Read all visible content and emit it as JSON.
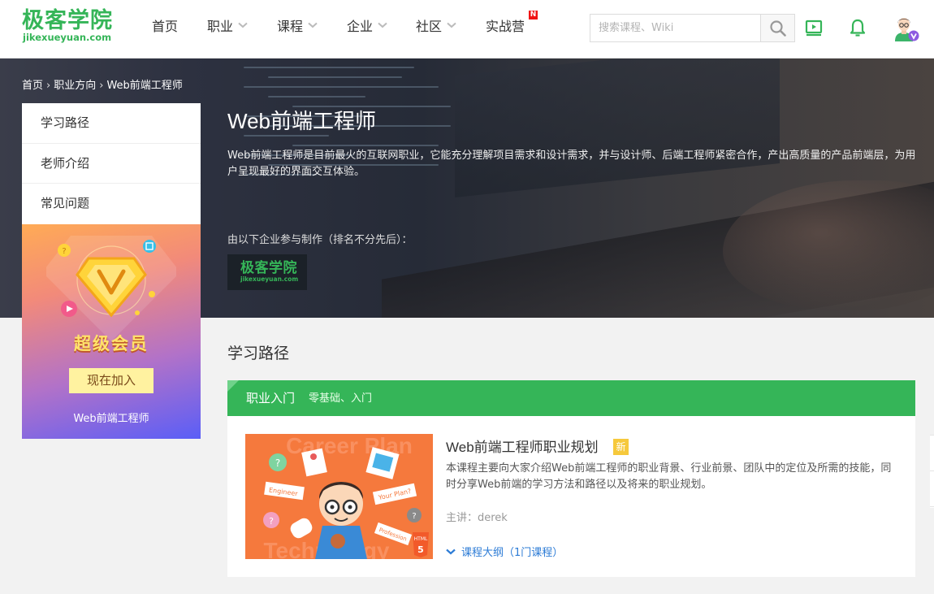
{
  "brand": {
    "logo_cn": "极客学院",
    "logo_en": "jikexueyuan.com",
    "color": "#35b558"
  },
  "nav": {
    "items": [
      {
        "label": "首页",
        "has_dropdown": false
      },
      {
        "label": "职业",
        "has_dropdown": true
      },
      {
        "label": "课程",
        "has_dropdown": true
      },
      {
        "label": "企业",
        "has_dropdown": true
      },
      {
        "label": "社区",
        "has_dropdown": true
      },
      {
        "label": "实战营",
        "has_dropdown": false,
        "badge": "N"
      }
    ]
  },
  "search": {
    "placeholder": "搜索课程、Wiki",
    "value": ""
  },
  "header_icons": [
    "video-icon",
    "bell-icon",
    "user-avatar-icon"
  ],
  "breadcrumb": [
    "首页",
    "职业方向",
    "Web前端工程师"
  ],
  "sidebar": {
    "items": [
      {
        "label": "学习路径"
      },
      {
        "label": "老师介绍"
      },
      {
        "label": "常见问题"
      }
    ],
    "vip": {
      "title": "超级会员",
      "button": "现在加入",
      "subtitle": "Web前端工程师"
    }
  },
  "job": {
    "title": "Web前端工程师",
    "description": "Web前端工程师是目前最火的互联网职业，它能充分理解项目需求和设计需求，并与设计师、后端工程师紧密合作，产出高质量的产品前端层，为用户呈现最好的界面交互体验。",
    "partners_label": "由以下企业参与制作（排名不分先后）：",
    "partner_logo_cn": "极客学院",
    "partner_logo_en": "jikexueyuan.com"
  },
  "learning_path": {
    "title": "学习路径",
    "stage": {
      "name": "职业入门",
      "subtitle": "零基础、入门"
    },
    "course": {
      "name": "Web前端工程师职业规划",
      "tag": "新",
      "description": "本课程主要向大家介绍Web前端工程师的职业背景、行业前景、团队中的定位及所需的技能，同时分享Web前端的学习方法和路径以及将来的职业规划。",
      "teacher": "主讲：derek",
      "outline": "课程大纲（1门课程）",
      "image_texts": {
        "top": "Career Plan",
        "bottom": "Technology",
        "tag1": "Engineer",
        "tag2": "Your Plan?",
        "tag3": "Profession",
        "html5": "HTML"
      }
    }
  }
}
